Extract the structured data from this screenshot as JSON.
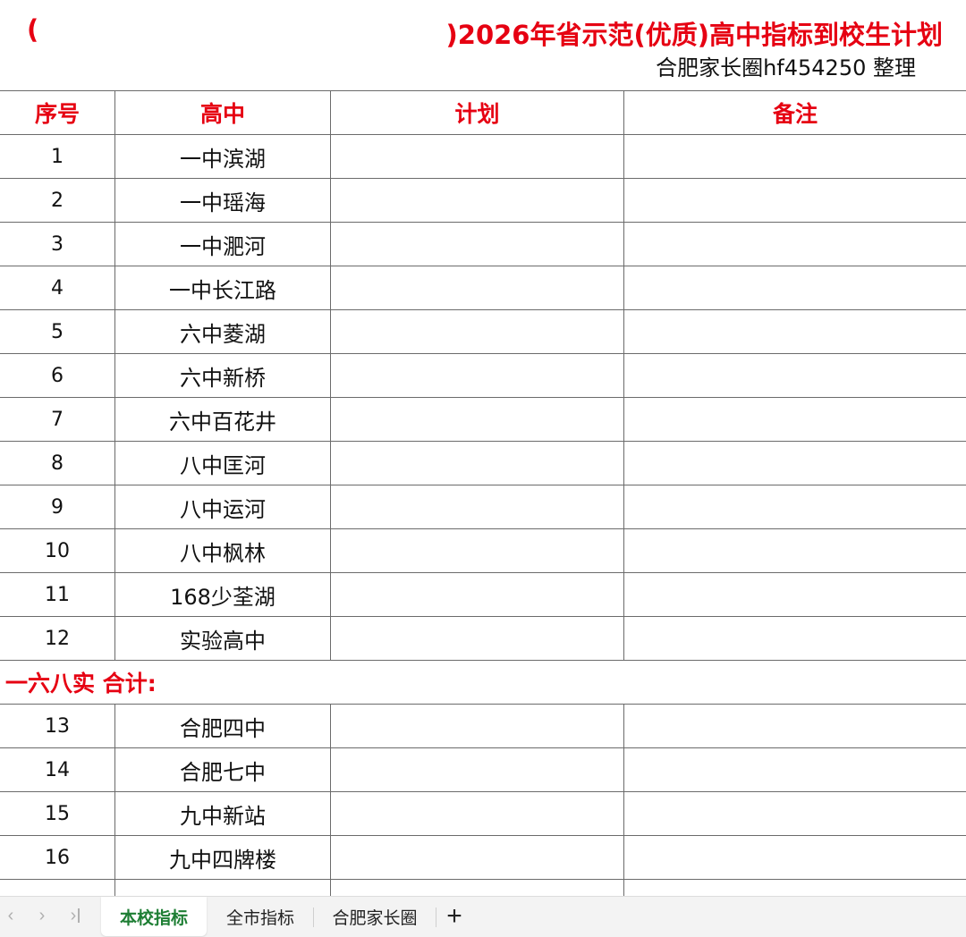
{
  "sheet": {
    "title_paren_left": "(",
    "title_text": ")2026年省示范(优质)高中指标到校生计划",
    "subtitle": "合肥家长圈hf454250 整理",
    "headers": {
      "no": "序号",
      "school": "高中",
      "plan": "计划",
      "note": "备注"
    },
    "rows_a": [
      {
        "no": "1",
        "school": "一中滨湖",
        "plan": "",
        "note": ""
      },
      {
        "no": "2",
        "school": "一中瑶海",
        "plan": "",
        "note": ""
      },
      {
        "no": "3",
        "school": "一中淝河",
        "plan": "",
        "note": ""
      },
      {
        "no": "4",
        "school": "一中长江路",
        "plan": "",
        "note": ""
      },
      {
        "no": "5",
        "school": "六中菱湖",
        "plan": "",
        "note": ""
      },
      {
        "no": "6",
        "school": "六中新桥",
        "plan": "",
        "note": ""
      },
      {
        "no": "7",
        "school": "六中百花井",
        "plan": "",
        "note": ""
      },
      {
        "no": "8",
        "school": "八中匡河",
        "plan": "",
        "note": ""
      },
      {
        "no": "9",
        "school": "八中运河",
        "plan": "",
        "note": ""
      },
      {
        "no": "10",
        "school": "八中枫林",
        "plan": "",
        "note": ""
      },
      {
        "no": "11",
        "school": "168少荃湖",
        "plan": "",
        "note": ""
      },
      {
        "no": "12",
        "school": "实验高中",
        "plan": "",
        "note": ""
      }
    ],
    "subtotal_label": "一六八实 合计:",
    "rows_b": [
      {
        "no": "13",
        "school": "合肥四中",
        "plan": "",
        "note": ""
      },
      {
        "no": "14",
        "school": "合肥七中",
        "plan": "",
        "note": ""
      },
      {
        "no": "15",
        "school": "九中新站",
        "plan": "",
        "note": ""
      },
      {
        "no": "16",
        "school": "九中四牌楼",
        "plan": "",
        "note": ""
      }
    ]
  },
  "tabbar": {
    "tabs": [
      {
        "label": "本校指标",
        "active": true
      },
      {
        "label": "全市指标",
        "active": false
      },
      {
        "label": "合肥家长圈",
        "active": false
      }
    ],
    "add_label": "+"
  },
  "colors": {
    "header_red": "#e60012",
    "active_tab_green": "#1e7e34",
    "grid_line": "#6b6b6b"
  }
}
